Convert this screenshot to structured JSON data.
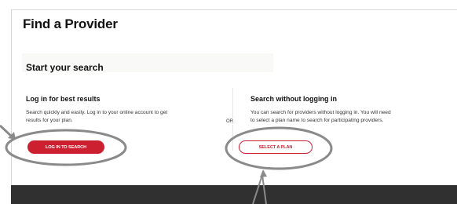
{
  "page": {
    "title": "Find a Provider",
    "subtitle": "Start your search"
  },
  "login_section": {
    "title": "Log in for best results",
    "description_line1": "Search quickly and easily. Log in to your online account to get",
    "description_line2": "results for your plan.",
    "button_label": "LOG IN TO SEARCH"
  },
  "divider": {
    "label": "OR"
  },
  "guest_section": {
    "title": "Search without logging in",
    "description_line1": "You can search for providers without logging in. You will need",
    "description_line2": "to select a plan name to search for participating providers.",
    "button_label": "SELECT A PLAN"
  },
  "colors": {
    "accent": "#cc1f2f",
    "footer": "#303030",
    "annotation": "#8a8a8a"
  }
}
